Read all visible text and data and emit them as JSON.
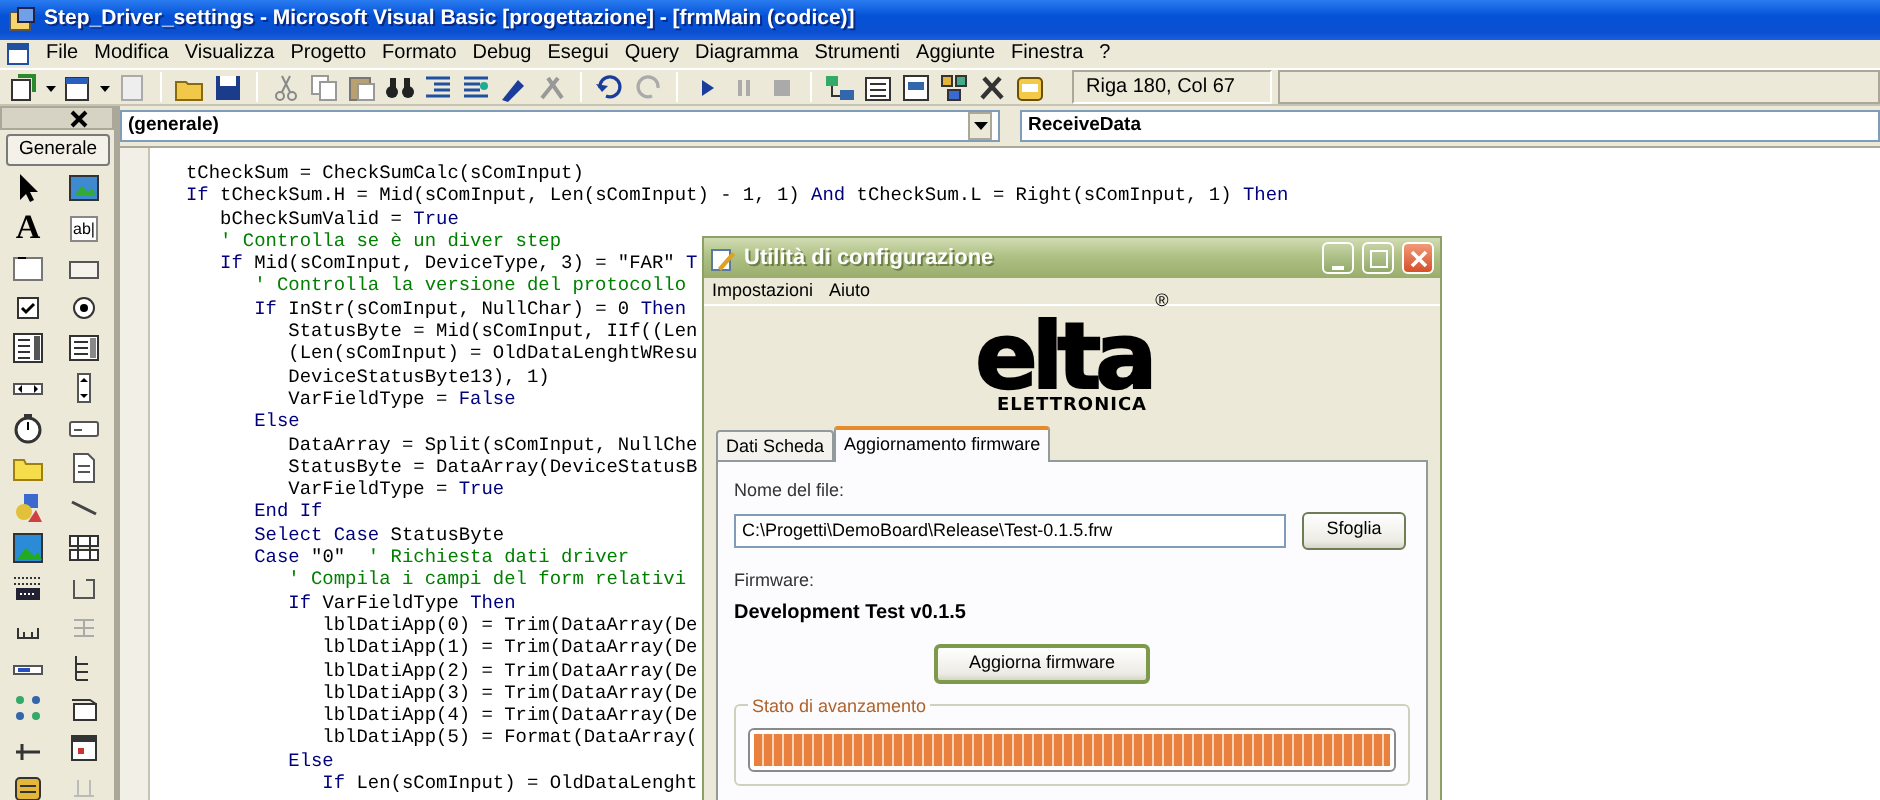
{
  "window": {
    "title": "Step_Driver_settings - Microsoft Visual Basic [progettazione] - [frmMain (codice)]"
  },
  "menu": [
    "File",
    "Modifica",
    "Visualizza",
    "Progetto",
    "Formato",
    "Debug",
    "Esegui",
    "Query",
    "Diagramma",
    "Strumenti",
    "Aggiunte",
    "Finestra",
    "?"
  ],
  "toolbar": {
    "position": "Riga 180, Col 67"
  },
  "toolbox": {
    "title": "Generale",
    "label_tool": "A",
    "textbox_tool": "ab|"
  },
  "code_window": {
    "object_combo": "(generale)",
    "procedure_combo": "ReceiveData",
    "lines": [
      [
        {
          "kind": "plain",
          "text": "tCheckSum = CheckSumCalc(sComInput)"
        }
      ],
      [
        {
          "kind": "keyword",
          "text": "If"
        },
        {
          "kind": "plain",
          "text": " tCheckSum.H = Mid(sComInput, Len(sComInput) - 1, 1) "
        },
        {
          "kind": "keyword",
          "text": "And"
        },
        {
          "kind": "plain",
          "text": " tCheckSum.L = Right(sComInput, 1) "
        },
        {
          "kind": "keyword",
          "text": "Then"
        }
      ],
      [
        {
          "kind": "plain",
          "text": "   bCheckSumValid = "
        },
        {
          "kind": "keyword",
          "text": "True"
        }
      ],
      [
        {
          "kind": "comment",
          "text": "   ' Controlla se è un diver step"
        }
      ],
      [
        {
          "kind": "keyword",
          "text": "   If"
        },
        {
          "kind": "plain",
          "text": " Mid(sComInput, DeviceType, 3) = \"FAR\" "
        },
        {
          "kind": "keyword",
          "text": "T"
        }
      ],
      [
        {
          "kind": "comment",
          "text": "      ' Controlla la versione del protocollo"
        }
      ],
      [
        {
          "kind": "keyword",
          "text": "      If"
        },
        {
          "kind": "plain",
          "text": " InStr(sComInput, NullChar) = 0 "
        },
        {
          "kind": "keyword",
          "text": "Then"
        }
      ],
      [
        {
          "kind": "plain",
          "text": "         StatusByte = Mid(sComInput, IIf((Len"
        }
      ],
      [
        {
          "kind": "plain",
          "text": "         (Len(sComInput) = OldDataLenghtWResu"
        }
      ],
      [
        {
          "kind": "plain",
          "text": "         DeviceStatusByte13), 1)"
        }
      ],
      [
        {
          "kind": "plain",
          "text": "         VarFieldType = "
        },
        {
          "kind": "keyword",
          "text": "False"
        }
      ],
      [
        {
          "kind": "keyword",
          "text": "      Else"
        }
      ],
      [
        {
          "kind": "plain",
          "text": "         DataArray = Split(sComInput, NullChe"
        }
      ],
      [
        {
          "kind": "plain",
          "text": "         StatusByte = DataArray(DeviceStatusB"
        }
      ],
      [
        {
          "kind": "plain",
          "text": "         VarFieldType = "
        },
        {
          "kind": "keyword",
          "text": "True"
        }
      ],
      [
        {
          "kind": "keyword",
          "text": "      End If"
        }
      ],
      [
        {
          "kind": "keyword",
          "text": "      Select Case"
        },
        {
          "kind": "plain",
          "text": " StatusByte"
        }
      ],
      [
        {
          "kind": "keyword",
          "text": "      Case"
        },
        {
          "kind": "plain",
          "text": " \"0\"  "
        },
        {
          "kind": "comment",
          "text": "' Richiesta dati driver"
        }
      ],
      [
        {
          "kind": "comment",
          "text": "         ' Compila i campi del form relativi"
        }
      ],
      [
        {
          "kind": "keyword",
          "text": "         If"
        },
        {
          "kind": "plain",
          "text": " VarFieldType "
        },
        {
          "kind": "keyword",
          "text": "Then"
        }
      ],
      [
        {
          "kind": "plain",
          "text": "            lblDatiApp(0) = Trim(DataArray(De"
        }
      ],
      [
        {
          "kind": "plain",
          "text": "            lblDatiApp(1) = Trim(DataArray(De"
        }
      ],
      [
        {
          "kind": "plain",
          "text": "            lblDatiApp(2) = Trim(DataArray(De"
        }
      ],
      [
        {
          "kind": "plain",
          "text": "            lblDatiApp(3) = Trim(DataArray(De"
        }
      ],
      [
        {
          "kind": "plain",
          "text": "            lblDatiApp(4) = Trim(DataArray(De"
        }
      ],
      [
        {
          "kind": "plain",
          "text": "            lblDatiApp(5) = Format(DataArray("
        }
      ],
      [
        {
          "kind": "keyword",
          "text": "         Else"
        }
      ],
      [
        {
          "kind": "keyword",
          "text": "            If"
        },
        {
          "kind": "plain",
          "text": " Len(sComInput) = OldDataLenght"
        }
      ]
    ]
  },
  "dialog": {
    "title": "Utilità di configurazione",
    "menu": [
      "Impostazioni",
      "Aiuto"
    ],
    "logo": {
      "wordmark": "elta",
      "mark": "®",
      "tagline": "ELETTRONICA"
    },
    "tabs": [
      {
        "label": "Dati Scheda",
        "selected": false
      },
      {
        "label": "Aggiornamento firmware",
        "selected": true
      }
    ],
    "file_label": "Nome del file:",
    "file_value": "C:\\Progetti\\DemoBoard\\Release\\Test-0.1.5.frw",
    "browse_button": "Sfoglia",
    "firmware_label": "Firmware:",
    "firmware_value": "Development Test v0.1.5",
    "update_button": "Aggiorna firmware",
    "progress": {
      "label": "Stato di avanzamento",
      "level": 1.0
    }
  }
}
